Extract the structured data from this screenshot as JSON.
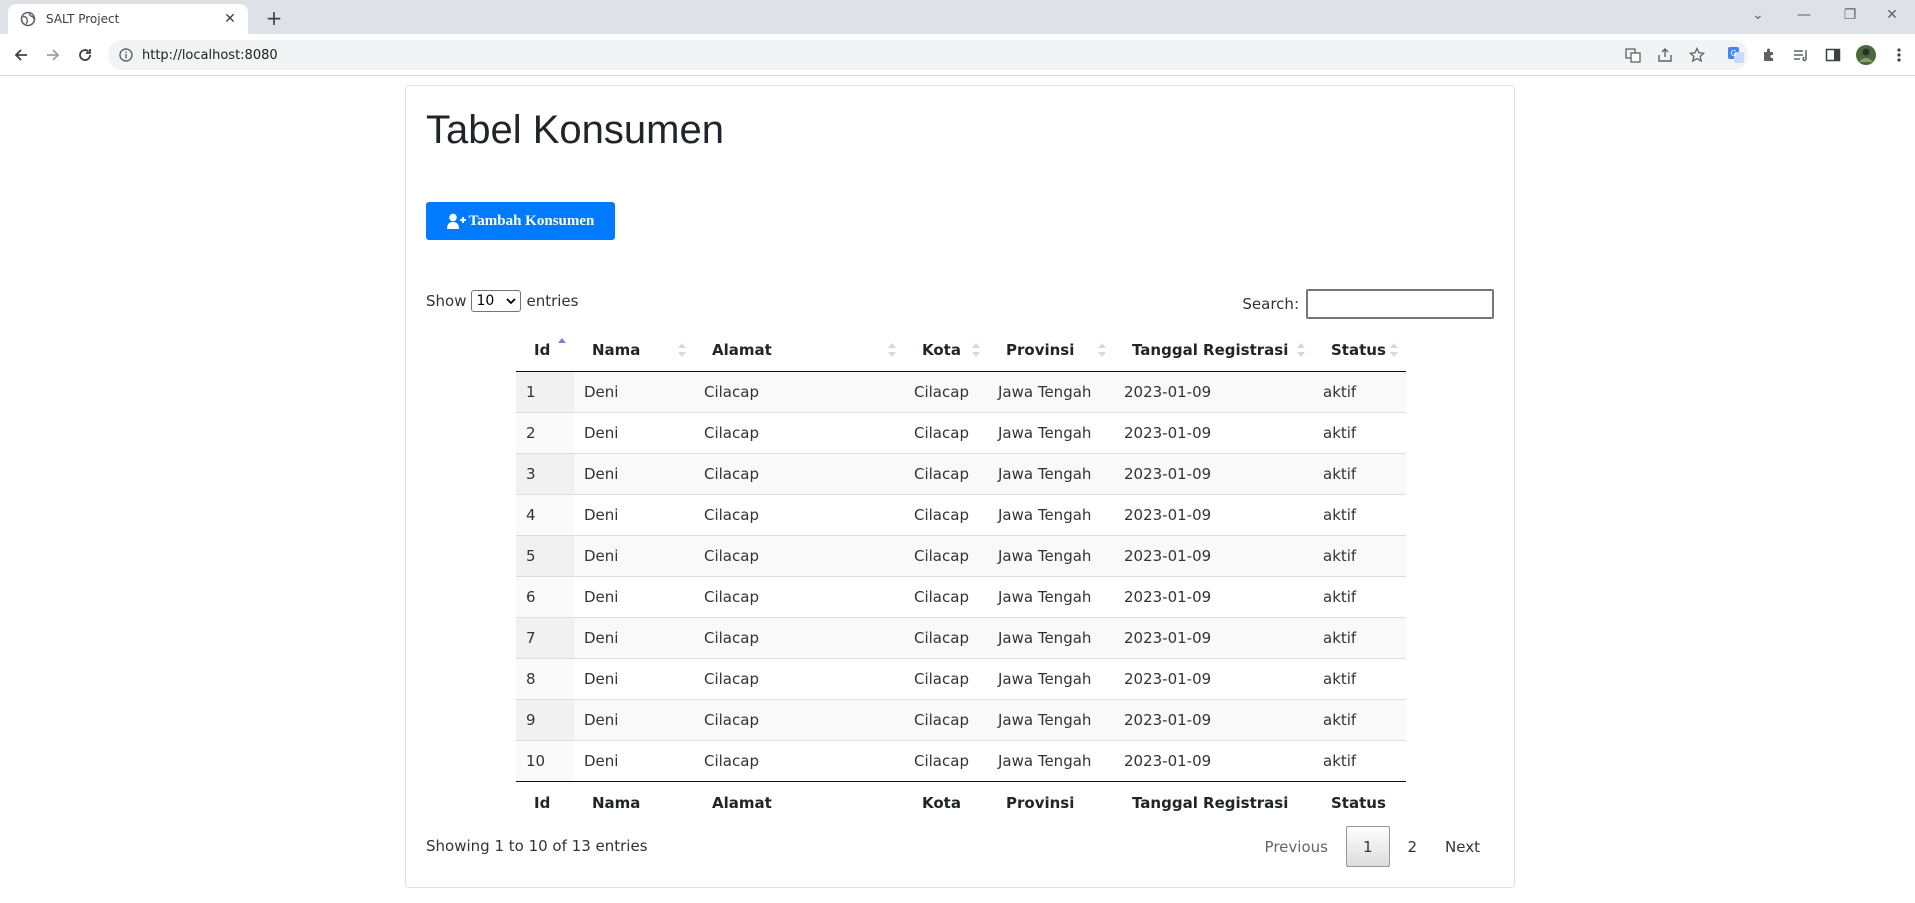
{
  "browser": {
    "tab_title": "SALT Project",
    "url": "http://localhost:8080"
  },
  "page": {
    "title": "Tabel Konsumen",
    "add_button": "Tambah Konsumen",
    "show_label": "Show",
    "entries_label": "entries",
    "page_length": "10",
    "search_label": "Search:",
    "search_value": ""
  },
  "table": {
    "columns": [
      "Id",
      "Nama",
      "Alamat",
      "Kota",
      "Provinsi",
      "Tanggal Registrasi",
      "Status"
    ],
    "rows": [
      [
        "1",
        "Deni",
        "Cilacap",
        "Cilacap",
        "Jawa Tengah",
        "2023-01-09",
        "aktif"
      ],
      [
        "2",
        "Deni",
        "Cilacap",
        "Cilacap",
        "Jawa Tengah",
        "2023-01-09",
        "aktif"
      ],
      [
        "3",
        "Deni",
        "Cilacap",
        "Cilacap",
        "Jawa Tengah",
        "2023-01-09",
        "aktif"
      ],
      [
        "4",
        "Deni",
        "Cilacap",
        "Cilacap",
        "Jawa Tengah",
        "2023-01-09",
        "aktif"
      ],
      [
        "5",
        "Deni",
        "Cilacap",
        "Cilacap",
        "Jawa Tengah",
        "2023-01-09",
        "aktif"
      ],
      [
        "6",
        "Deni",
        "Cilacap",
        "Cilacap",
        "Jawa Tengah",
        "2023-01-09",
        "aktif"
      ],
      [
        "7",
        "Deni",
        "Cilacap",
        "Cilacap",
        "Jawa Tengah",
        "2023-01-09",
        "aktif"
      ],
      [
        "8",
        "Deni",
        "Cilacap",
        "Cilacap",
        "Jawa Tengah",
        "2023-01-09",
        "aktif"
      ],
      [
        "9",
        "Deni",
        "Cilacap",
        "Cilacap",
        "Jawa Tengah",
        "2023-01-09",
        "aktif"
      ],
      [
        "10",
        "Deni",
        "Cilacap",
        "Cilacap",
        "Jawa Tengah",
        "2023-01-09",
        "aktif"
      ]
    ],
    "sorted_column": "Id"
  },
  "footer": {
    "info": "Showing 1 to 10 of 13 entries",
    "previous": "Previous",
    "pages": [
      "1",
      "2"
    ],
    "current_page": "1",
    "next": "Next"
  },
  "colors": {
    "primary_button": "#007bff",
    "sort_active": "#7e7ed8"
  }
}
